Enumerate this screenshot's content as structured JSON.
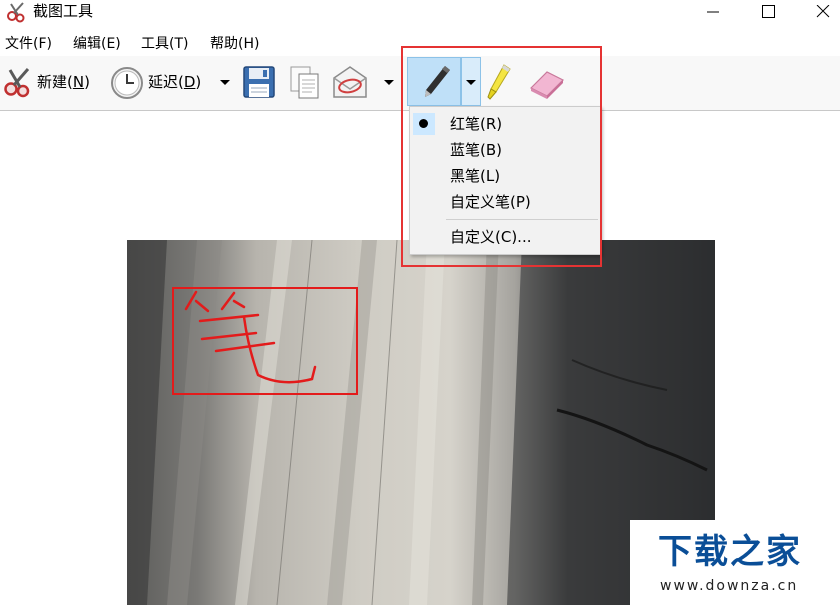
{
  "window": {
    "title": "截图工具",
    "app_icon": "scissors-icon",
    "controls": {
      "minimize": "minimize-icon",
      "maximize": "maximize-icon",
      "close": "close-icon"
    }
  },
  "menubar": {
    "items": [
      {
        "label": "文件(F)"
      },
      {
        "label": "编辑(E)"
      },
      {
        "label": "工具(T)"
      },
      {
        "label": "帮助(H)"
      }
    ]
  },
  "toolbar": {
    "new": {
      "label_prefix": "新建(",
      "mnemonic": "N",
      "label_suffix": ")",
      "icon": "scissors-icon"
    },
    "delay": {
      "label_prefix": "延迟(",
      "mnemonic": "D",
      "label_suffix": ")",
      "icon": "clock-icon"
    },
    "save_icon": "floppy-disk-icon",
    "copy_icon": "copy-icon",
    "send_icon": "envelope-icon",
    "pen_icon": "pen-icon",
    "highlighter_icon": "highlighter-icon",
    "eraser_icon": "eraser-icon"
  },
  "pen_menu": {
    "items": [
      {
        "label": "红笔(R)",
        "checked": true
      },
      {
        "label": "蓝笔(B)",
        "checked": false
      },
      {
        "label": "黑笔(L)",
        "checked": false
      },
      {
        "label": "自定义笔(P)",
        "checked": false
      }
    ],
    "customize": {
      "label": "自定义(C)..."
    }
  },
  "annotation": {
    "pen_color": "#e31b1b",
    "highlight_color": "#e53333"
  },
  "watermark": {
    "title": "下载之家",
    "url": "www.downza.cn",
    "color": "#0a4e97"
  }
}
